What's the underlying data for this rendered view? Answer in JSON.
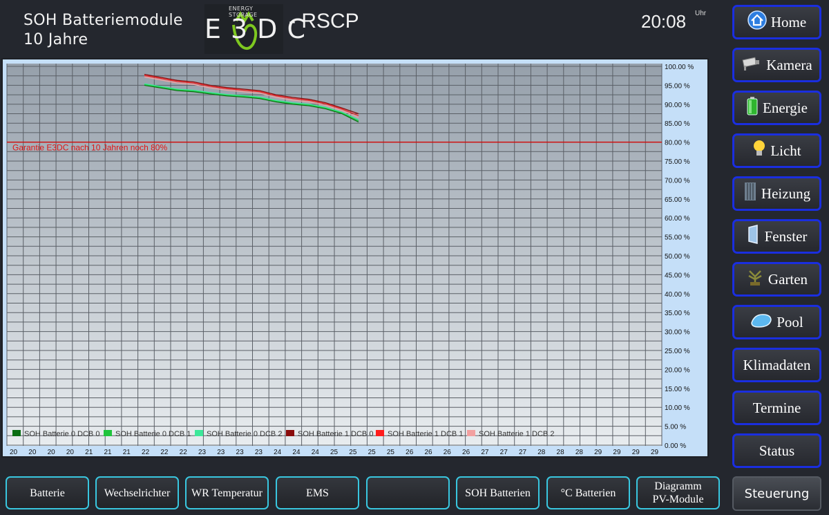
{
  "header": {
    "title": "SOH Batteriemodule",
    "subtitle": "10 Jahre",
    "logo_small": "ENERGY STORAGE",
    "logo_text": "E3DC",
    "product": "- RSCP",
    "time": "20:08",
    "time_unit": "Uhr"
  },
  "nav": [
    {
      "label": "Home",
      "icon": "home-icon"
    },
    {
      "label": "Kamera",
      "icon": "camera-icon"
    },
    {
      "label": "Energie",
      "icon": "battery-icon"
    },
    {
      "label": "Licht",
      "icon": "lightbulb-icon"
    },
    {
      "label": "Heizung",
      "icon": "heater-icon"
    },
    {
      "label": "Fenster",
      "icon": "window-icon"
    },
    {
      "label": "Garten",
      "icon": "garden-icon"
    },
    {
      "label": "Pool",
      "icon": "pool-icon"
    },
    {
      "label": "Klimadaten",
      "icon": ""
    },
    {
      "label": "Termine",
      "icon": ""
    },
    {
      "label": "Status",
      "icon": ""
    }
  ],
  "steuerung": "Steuerung",
  "bottom_tabs": [
    "Batterie",
    "Wechselrichter",
    "WR Temperatur",
    "EMS",
    "",
    "SOH Batterien",
    "°C Batterien",
    "Diagramm\nPV-Module"
  ],
  "colors": {
    "nav_border": "#1a2ee0",
    "tab_border": "#39c7e0",
    "threshold_line": "#d01010"
  },
  "chart_data": {
    "type": "line",
    "ylim": [
      0,
      100
    ],
    "ytick_labels": [
      "100.00 %",
      "95.00 %",
      "90.00 %",
      "85.00 %",
      "80.00 %",
      "75.00 %",
      "70.00 %",
      "65.00 %",
      "60.00 %",
      "55.00 %",
      "50.00 %",
      "45.00 %",
      "40.00 %",
      "35.00 %",
      "30.00 %",
      "25.00 %",
      "20.00 %",
      "15.00 %",
      "10.00 %",
      "5.00 %",
      "0.00 %"
    ],
    "x_tick_labels": [
      "20",
      "20",
      "20",
      "20",
      "21",
      "21",
      "21",
      "22",
      "22",
      "22",
      "23",
      "23",
      "23",
      "23",
      "24",
      "24",
      "24",
      "25",
      "25",
      "25",
      "25",
      "26",
      "26",
      "26",
      "26",
      "27",
      "27",
      "27",
      "28",
      "28",
      "28",
      "29",
      "29",
      "29",
      "29"
    ],
    "grid": true,
    "legend_position": "bottom-left",
    "annotation": {
      "text": "Garantie E3DC nach 10 Jahren noch 80%",
      "y": 80
    },
    "x": [
      0,
      1,
      2,
      3,
      4,
      5,
      6,
      7,
      8,
      9,
      10,
      11,
      12,
      13
    ],
    "series": [
      {
        "name": "SOH Batterie 0 DCB 0",
        "color": "#0a6e14",
        "values": [
          95.0,
          94.3,
          93.6,
          93.3,
          92.7,
          92.2,
          91.9,
          91.5,
          90.6,
          90.0,
          89.6,
          88.8,
          87.5,
          85.3
        ]
      },
      {
        "name": "SOH Batterie 0 DCB 1",
        "color": "#1fc43c",
        "values": [
          95.2,
          94.5,
          93.8,
          93.5,
          92.9,
          92.4,
          92.1,
          91.7,
          90.8,
          90.2,
          89.8,
          89.0,
          87.7,
          85.6
        ]
      },
      {
        "name": "SOH Batterie 0 DCB 2",
        "color": "#3de89a",
        "values": [
          95.4,
          94.7,
          94.0,
          93.7,
          93.1,
          92.6,
          92.3,
          91.9,
          91.0,
          90.4,
          90.0,
          89.2,
          87.9,
          85.9
        ]
      },
      {
        "name": "SOH Batterie 1 DCB 0",
        "color": "#8a0c0c",
        "values": [
          97.9,
          97.1,
          96.3,
          95.9,
          95.0,
          94.4,
          94.0,
          93.6,
          92.5,
          91.8,
          91.3,
          90.4,
          89.0,
          87.5
        ]
      },
      {
        "name": "SOH Batterie 1 DCB 1",
        "color": "#ff1c1c",
        "values": [
          97.6,
          96.8,
          96.0,
          95.6,
          94.7,
          94.1,
          93.7,
          93.3,
          92.2,
          91.5,
          91.0,
          90.1,
          88.7,
          87.0
        ]
      },
      {
        "name": "SOH Batterie 1 DCB 2",
        "color": "#f2a0a0",
        "values": [
          97.2,
          96.4,
          95.6,
          95.2,
          94.3,
          93.7,
          93.3,
          92.9,
          91.8,
          91.1,
          90.6,
          89.7,
          88.3,
          86.5
        ]
      }
    ]
  }
}
